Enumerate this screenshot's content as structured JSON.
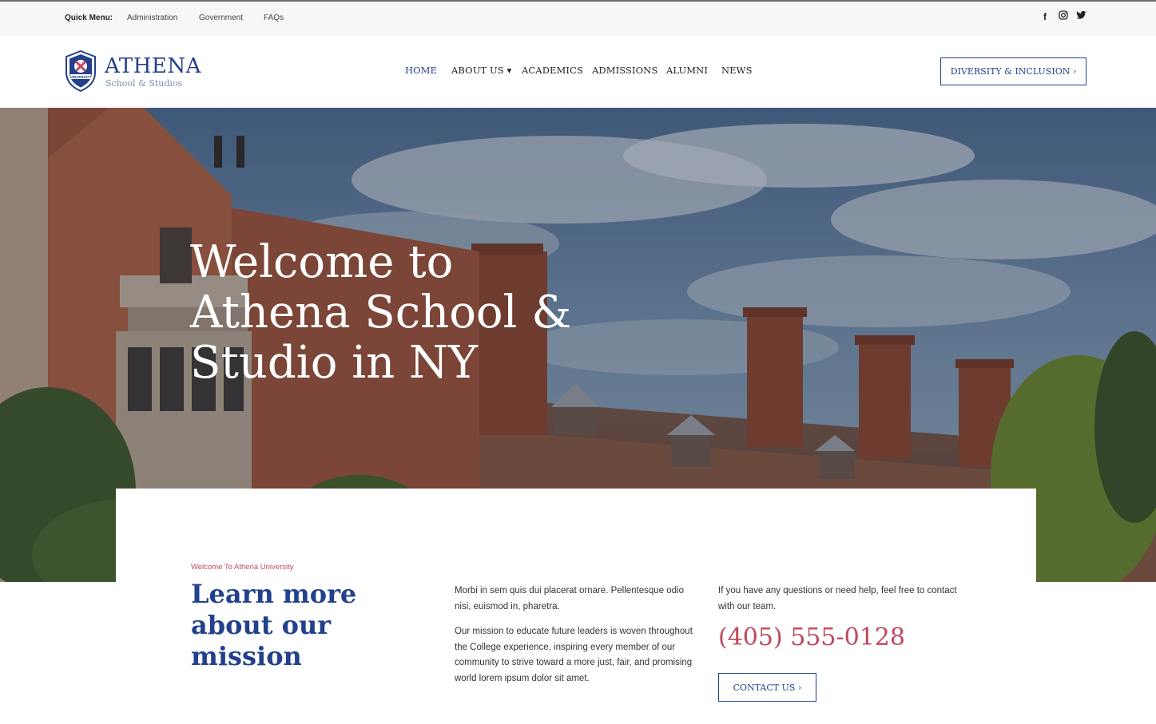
{
  "topbar": {
    "quick_menu_label": "Quick Menu:",
    "items": [
      {
        "label": "Administration"
      },
      {
        "label": "Government"
      },
      {
        "label": "FAQs"
      }
    ],
    "social": [
      {
        "icon": "facebook-icon",
        "glyph": "f"
      },
      {
        "icon": "instagram-icon",
        "glyph": "◎"
      },
      {
        "icon": "twitter-icon",
        "glyph": "✦"
      }
    ]
  },
  "header": {
    "logo": {
      "name": "ATHENA",
      "subtitle": "School & Studios",
      "shield_text": "UNIVERSITY"
    },
    "nav": [
      {
        "label": "HOME",
        "active": true
      },
      {
        "label": "ABOUT US ▾",
        "active": false
      },
      {
        "label": "ACADEMICS",
        "active": false
      },
      {
        "label": "ADMISSIONS",
        "active": false
      },
      {
        "label": "ALUMNI",
        "active": false
      },
      {
        "label": "NEWS",
        "active": false
      }
    ],
    "cta_label": "DIVERSITY & INCLUSION ›"
  },
  "hero": {
    "title": "Welcome to Athena School & Studio in NY"
  },
  "mission": {
    "eyebrow": "Welcome To Athena University",
    "title": "Learn more about our mission",
    "paragraph1": "Morbi in sem quis dui placerat ornare. Pellentesque odio nisi, euismod in, pharetra.",
    "paragraph2": "Our mission to educate future leaders is woven throughout the College experience, inspiring every member of our community to strive toward a more just, fair, and promising world lorem ipsum dolor sit amet.",
    "help_text": "If you have any questions or need help, feel free to contact with our team.",
    "phone": "(405) 555-0128",
    "contact_label": "CONTACT US ›"
  },
  "colors": {
    "brand_blue": "#23408e",
    "accent_red": "#c0485c"
  }
}
